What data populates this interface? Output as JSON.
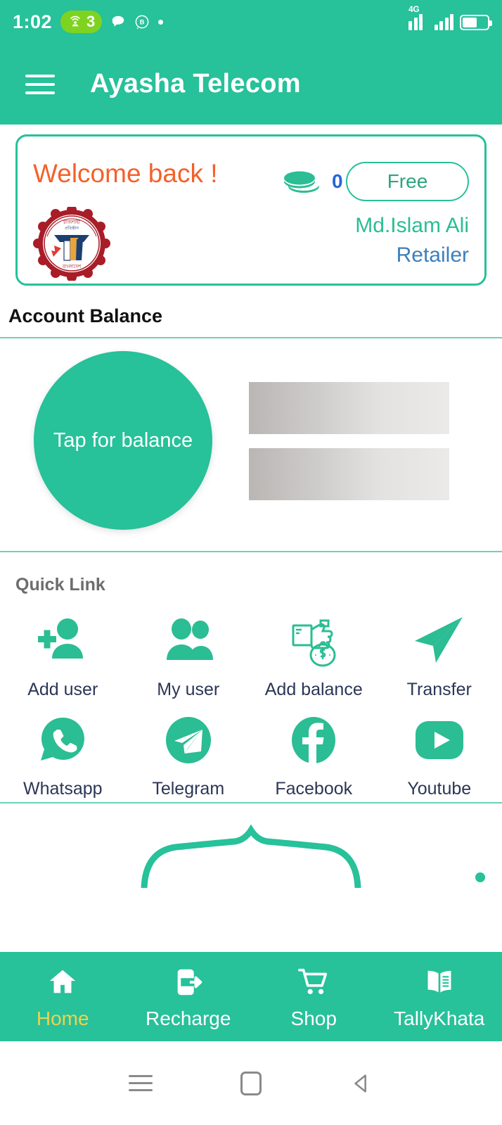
{
  "status_bar": {
    "time": "1:02",
    "hotspot_count": "3",
    "hotspot_icon": "wifi-tethering-icon",
    "chat_icon": "chat-bubble-icon",
    "badge_icon": "b-circle-icon",
    "dot_icon": "dot-icon",
    "network_label": "4G",
    "signal_icon": "signal-bars-icon",
    "signal_icon_2": "signal-bars-icon",
    "battery_icon": "battery-icon"
  },
  "app_bar": {
    "menu_icon": "hamburger-menu-icon",
    "title": "Ayasha Telecom"
  },
  "welcome_card": {
    "greeting": "Welcome back !",
    "coins_icon": "coins-stack-icon",
    "coin_count": "0",
    "plan_label": "Free",
    "logo_icon": "company-seal-logo",
    "user_name": "Md.Islam Ali",
    "user_role": "Retailer"
  },
  "account_balance": {
    "heading": "Account Balance",
    "tap_label": "Tap for balance",
    "placeholder_rows": 2
  },
  "quick_link": {
    "heading": "Quick Link",
    "items": [
      {
        "label": "Add user",
        "icon": "person-add-icon"
      },
      {
        "label": "My user",
        "icon": "people-group-icon"
      },
      {
        "label": "Add balance",
        "icon": "hand-money-bag-icon"
      },
      {
        "label": "Transfer",
        "icon": "paper-plane-icon"
      },
      {
        "label": "Whatsapp",
        "icon": "whatsapp-icon"
      },
      {
        "label": "Telegram",
        "icon": "telegram-icon"
      },
      {
        "label": "Facebook",
        "icon": "facebook-icon"
      },
      {
        "label": "Youtube",
        "icon": "youtube-icon"
      }
    ]
  },
  "bottom_nav": {
    "items": [
      {
        "label": "Home",
        "icon": "home-icon",
        "active": true
      },
      {
        "label": "Recharge",
        "icon": "recharge-icon",
        "active": false
      },
      {
        "label": "Shop",
        "icon": "shopping-cart-icon",
        "active": false
      },
      {
        "label": "TallyKhata",
        "icon": "open-book-icon",
        "active": false
      }
    ]
  },
  "system_nav": {
    "recents_icon": "recents-icon",
    "home_icon": "home-square-icon",
    "back_icon": "back-triangle-icon"
  },
  "colors": {
    "primary": "#27c19a",
    "accent_orange": "#f4612a",
    "accent_blue": "#2b63d9",
    "role_blue": "#3d7fbd",
    "active_nav": "#ecd34e"
  }
}
